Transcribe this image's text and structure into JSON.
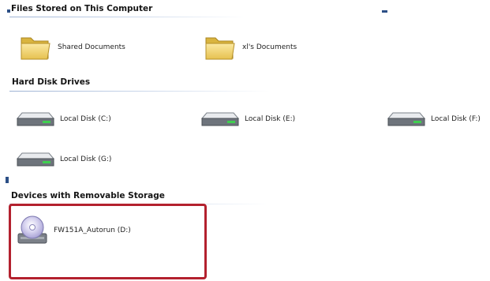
{
  "sections": {
    "files_stored": {
      "title": "Files Stored on This Computer",
      "items": [
        {
          "label": "Shared Documents",
          "icon": "folder-icon"
        },
        {
          "label": "xl's Documents",
          "icon": "folder-icon"
        }
      ]
    },
    "hard_disks": {
      "title": "Hard Disk Drives",
      "items": [
        {
          "label": "Local Disk (C:)",
          "icon": "hard-disk-icon"
        },
        {
          "label": "Local Disk (E:)",
          "icon": "hard-disk-icon"
        },
        {
          "label": "Local Disk (F:)",
          "icon": "hard-disk-icon"
        },
        {
          "label": "Local Disk (G:)",
          "icon": "hard-disk-icon"
        }
      ]
    },
    "removable": {
      "title": "Devices with Removable Storage",
      "items": [
        {
          "label": "FW151A_Autorun (D:)",
          "icon": "cd-drive-icon"
        }
      ]
    }
  },
  "colors": {
    "highlight_border": "#b3212e",
    "header_line": "#9db2d3"
  }
}
